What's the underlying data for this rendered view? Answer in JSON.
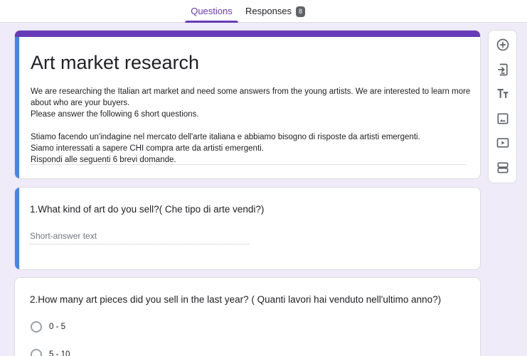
{
  "tabs": {
    "questions_label": "Questions",
    "responses_label": "Responses",
    "responses_count": "8"
  },
  "form": {
    "title": "Art market research",
    "description": "We are researching the Italian art market and need some answers from the young artists. We are interested to learn more about who are your buyers.\nPlease answer the following 6 short questions.\n\nStiamo facendo un'indagine nel mercato dell'arte italiana e abbiamo bisogno di risposte da artisti emergenti.\nSiamo interessati a sapere CHI compra arte da artisti emergenti.\nRispondi alle seguenti 6 brevi domande."
  },
  "questions": [
    {
      "title": "1.What kind of art do you sell?( Che tipo di arte vendi?)",
      "placeholder": "Short-answer text"
    },
    {
      "title": "2.How many art pieces did you sell in the last year? ( Quanti lavori hai venduto nell'ultimo anno?)",
      "options": [
        "0 - 5",
        "5 - 10"
      ]
    }
  ],
  "toolbar": {
    "icons": [
      "add-question-icon",
      "import-questions-icon",
      "add-title-icon",
      "add-image-icon",
      "add-video-icon",
      "add-section-icon"
    ]
  },
  "colors": {
    "accent": "#673ab7",
    "selected_stripe": "#4285f4",
    "background": "#f0ebf8"
  }
}
